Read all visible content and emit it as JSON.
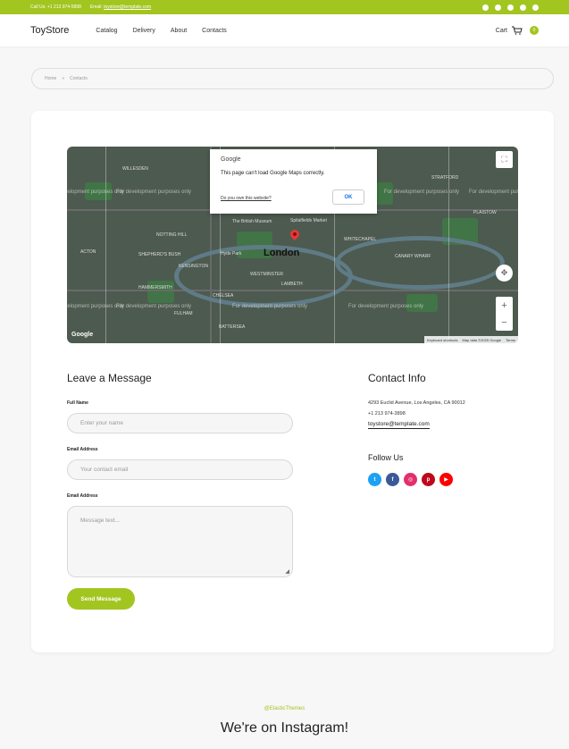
{
  "topbar": {
    "call_label": "Call Us: +1 213 974-5898",
    "email_label": "Email:",
    "email_value": "toystore@template.com",
    "social_icons": [
      "twitter-icon",
      "facebook-icon",
      "instagram-icon",
      "pinterest-icon",
      "youtube-icon"
    ]
  },
  "header": {
    "logo": "ToyStore",
    "nav": [
      "Catalog",
      "Delivery",
      "About",
      "Contacts"
    ],
    "cart_label": "Cart",
    "cart_count": "0"
  },
  "breadcrumb": {
    "home": "Home",
    "separator": "»",
    "current": "Contacts"
  },
  "map": {
    "city_label": "London",
    "dev_watermark": "For development purposes only",
    "district_labels": [
      "WILLESDEN",
      "NOTTING HILL",
      "SHEPHERD'S BUSH",
      "KENSINGTON",
      "HAMMERSMITH",
      "FULHAM",
      "CHELSEA",
      "WESTMINSTER",
      "LAMBETH",
      "BATTERSEA",
      "ACTON",
      "WHITECHAPEL",
      "CANARY WHARF",
      "STRATFORD",
      "PLAISTOW",
      "Hyde Park",
      "The British Museum",
      "Spitalfields Market"
    ],
    "dialog_brand": "Google",
    "dialog_message": "This page can't load Google Maps correctly.",
    "dialog_link": "Do you own this website?",
    "dialog_ok": "OK",
    "google_logo": "Google",
    "footer": [
      "Keyboard shortcuts",
      "Map data ©2025 Google",
      "Terms"
    ]
  },
  "form": {
    "title": "Leave a Message",
    "name_label": "Full Name",
    "name_placeholder": "Enter your name",
    "email_label": "Email Address",
    "email_placeholder": "Your contact email",
    "message_label": "Email Address",
    "message_placeholder": "Message text...",
    "send_label": "Send Message"
  },
  "contact": {
    "title": "Contact Info",
    "address": "4293  Euclid Avenue, Los Angeles, CA 90012",
    "phone": "+1 213 974-3898",
    "email": "toystore@template.com",
    "follow_title": "Follow Us",
    "socials": [
      {
        "name": "twitter-icon",
        "glyph": "t",
        "color": "#1da1f2"
      },
      {
        "name": "facebook-icon",
        "glyph": "f",
        "color": "#3b5998"
      },
      {
        "name": "instagram-icon",
        "glyph": "◎",
        "color": "#e1306c"
      },
      {
        "name": "pinterest-icon",
        "glyph": "p",
        "color": "#bd081c"
      },
      {
        "name": "youtube-icon",
        "glyph": "▶",
        "color": "#ff0000"
      }
    ]
  },
  "instagram": {
    "tag": "@ElasticThemes",
    "title": "We're on Instagram!"
  },
  "colors": {
    "accent": "#a3c520"
  }
}
